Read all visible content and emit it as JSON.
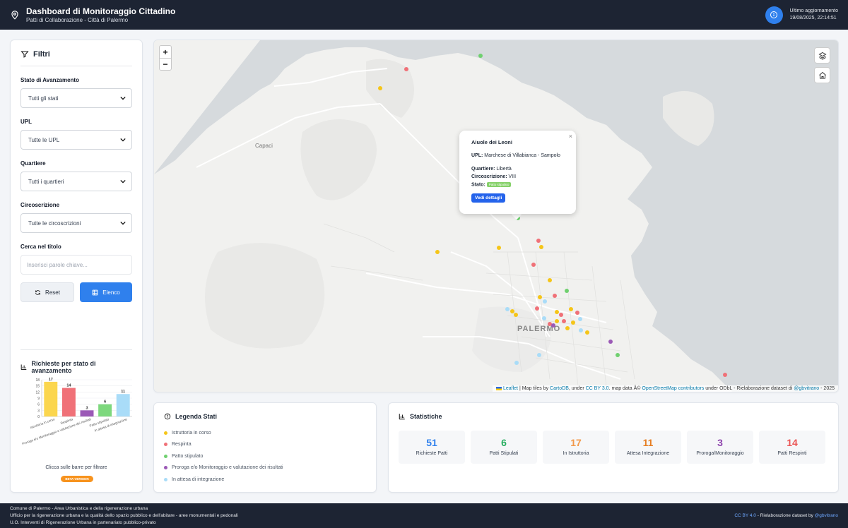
{
  "header": {
    "title": "Dashboard di Monitoraggio Cittadino",
    "subtitle": "Patti di Collaborazione - Città di Palermo",
    "update_label": "Ultimo aggiornamento",
    "update_value": "19/08/2025, 22:14:51"
  },
  "filters": {
    "title": "Filtri",
    "stato_label": "Stato di Avanzamento",
    "stato_value": "Tutti gli stati",
    "upl_label": "UPL",
    "upl_value": "Tutte le UPL",
    "quartiere_label": "Quartiere",
    "quartiere_value": "Tutti i quartieri",
    "circoscrizione_label": "Circoscrizione",
    "circoscrizione_value": "Tutte le circoscrizioni",
    "search_label": "Cerca nel titolo",
    "search_placeholder": "Inserisci parole chiave...",
    "reset_label": "Reset",
    "list_label": "Elenco",
    "chart_title": "Richieste per stato di avanzamento",
    "chart_hint": "Clicca sulle barre per filtrare",
    "beta_label": "BETA VERSION"
  },
  "chart_data": {
    "type": "bar",
    "categories": [
      "Istruttoria in corso",
      "Respinta",
      "Proroga e/o Monitoraggio e valutazione dei risultati",
      "Patto stipulato",
      "In attesa di integrazione"
    ],
    "values": [
      17,
      14,
      3,
      6,
      11
    ],
    "colors": [
      "#fbd64e",
      "#f07178",
      "#9b59b6",
      "#7dd87d",
      "#a9dcf8"
    ],
    "yticks": [
      0,
      3,
      6,
      9,
      12,
      15,
      18
    ],
    "ylim": [
      0,
      18
    ]
  },
  "map": {
    "zoom_in": "+",
    "zoom_out": "−",
    "label_capaci": "Capaci",
    "label_palermo": "PALERMO",
    "popup": {
      "title": "Aiuole dei Leoni",
      "upl_label": "UPL:",
      "upl_value": "Marchese di Villabianca - Sampolo",
      "quartiere_label": "Quartiere:",
      "quartiere_value": "Libertà",
      "circ_label": "Circoscrizione:",
      "circ_value": "VIII",
      "stato_label": "Stato:",
      "stato_value": "Patto stipulato",
      "button": "Vedi dettagli",
      "close": "×"
    },
    "attribution": {
      "leaflet": "Leaflet",
      "t1": " | Map tiles by ",
      "cartodb": "CartoDB",
      "t2": ", under ",
      "ccby": "CC BY 3.0",
      "t3": ". map data Â© ",
      "osm": "OpenStreetMap contributors",
      "t4": " under ODbL - Rielaborazione dataset di ",
      "user": "@gbvitrano",
      "t5": " - 2025"
    }
  },
  "legend": {
    "title": "Legenda Stati",
    "items": [
      {
        "label": "Istruttoria in corso",
        "color": "#f5c518"
      },
      {
        "label": "Respinta",
        "color": "#f07178"
      },
      {
        "label": "Patto stipulato",
        "color": "#6fd06f"
      },
      {
        "label": "Proroga e/o Monitoraggio e valutazione dei risultati",
        "color": "#9b59b6"
      },
      {
        "label": "In attesa di integrazione",
        "color": "#a9dcf8"
      }
    ]
  },
  "stats": {
    "title": "Statistiche",
    "cards": [
      {
        "value": "51",
        "label": "Richieste Patti",
        "color": "#2f80ed"
      },
      {
        "value": "6",
        "label": "Patti Stipulati",
        "color": "#27ae60"
      },
      {
        "value": "17",
        "label": "In Istruttoria",
        "color": "#f2994a"
      },
      {
        "value": "11",
        "label": "Attesa Integrazione",
        "color": "#e67e22"
      },
      {
        "value": "3",
        "label": "Proroga/Monitoraggio",
        "color": "#8e44ad"
      },
      {
        "value": "14",
        "label": "Patti Respinti",
        "color": "#eb5757"
      }
    ]
  },
  "footer": {
    "line1": "Comune di Palermo - Area Urbanistica e della rigenerazione urbana",
    "line2": "Ufficio per la rigenerazione urbana e la qualità dello spazio pubblico e dell'abitare - aree monumentali e pedonali",
    "line3": "U.O. Interventi di Rigenerazione Urbana in partenariato pubblico-privato",
    "license": "CC BY 4.0",
    "credit_text": " - Rielaborazione dataset by ",
    "credit_user": "@gbvitrano"
  }
}
